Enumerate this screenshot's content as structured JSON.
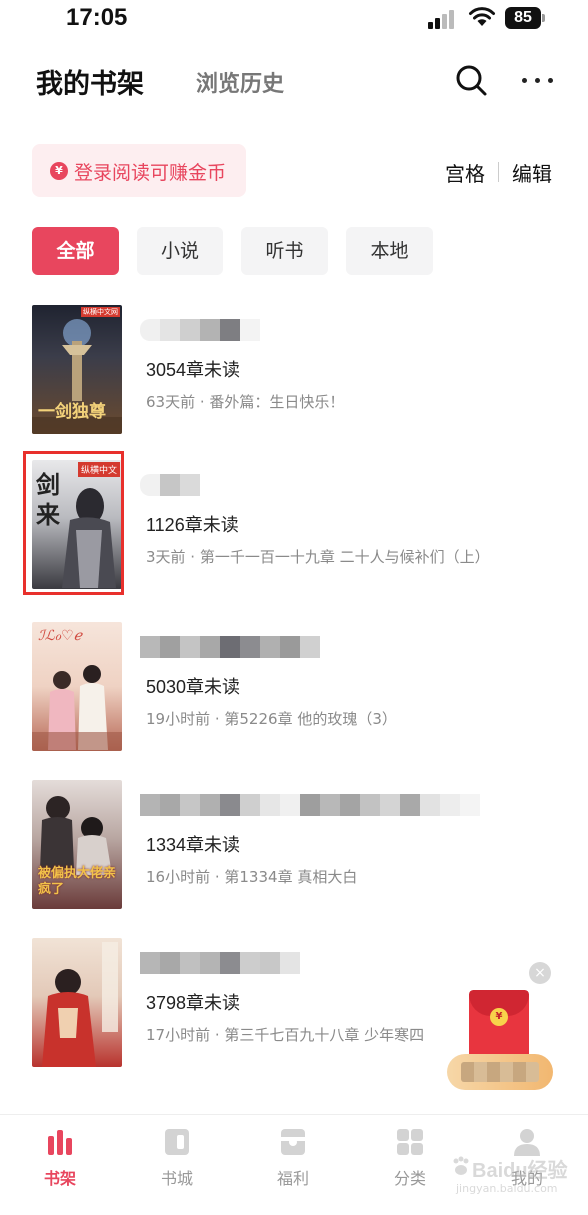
{
  "status_bar": {
    "time": "17:05",
    "battery": "85"
  },
  "header": {
    "tab_shelf": "我的书架",
    "tab_history": "浏览历史"
  },
  "banner": {
    "coin_symbol": "¥",
    "text": "登录阅读可赚金币"
  },
  "view_toggle": {
    "grid_label": "宫格",
    "edit_label": "编辑"
  },
  "filters": [
    {
      "label": "全部",
      "active": true
    },
    {
      "label": "小说",
      "active": false
    },
    {
      "label": "听书",
      "active": false
    },
    {
      "label": "本地",
      "active": false
    }
  ],
  "books": [
    {
      "unread": "3054章未读",
      "meta": "63天前 · 番外篇：生日快乐！",
      "cover_text": "一剑独尊",
      "cover_badge": "纵横中文网",
      "cover_colors": [
        "#2a2d38",
        "#6b4a2e"
      ]
    },
    {
      "unread": "1126章未读",
      "meta": "3天前 · 第一千一百一十九章 二十人与候补们（上）",
      "cover_text": "剑来",
      "cover_badge": "纵横中文",
      "cover_colors": [
        "#c9cbd0",
        "#3a3a40"
      ]
    },
    {
      "unread": "5030章未读",
      "meta": "19小时前 · 第5226章 他的玫瑰（3）",
      "cover_text": "",
      "cover_badge": "",
      "cover_colors": [
        "#f3ddd0",
        "#b86a58"
      ]
    },
    {
      "unread": "1334章未读",
      "meta": "16小时前 · 第1334章 真相大白",
      "cover_text": "被偏执大佬亲疯了",
      "cover_badge": "",
      "cover_colors": [
        "#d9d2cf",
        "#6a3b3a"
      ]
    },
    {
      "unread": "3798章未读",
      "meta": "17小时前 · 第三千七百九十八章 少年寒四",
      "cover_text": "",
      "cover_badge": "",
      "cover_colors": [
        "#e9d6c8",
        "#b8332e"
      ]
    }
  ],
  "redpacket": {
    "close_symbol": "×",
    "seal": "¥"
  },
  "tab_bar": [
    {
      "label": "书架",
      "icon": "bookshelf-icon",
      "active": true
    },
    {
      "label": "书城",
      "icon": "book-store-icon",
      "active": false
    },
    {
      "label": "福利",
      "icon": "gift-box-icon",
      "active": false
    },
    {
      "label": "分类",
      "icon": "category-grid-icon",
      "active": false
    },
    {
      "label": "我的",
      "icon": "profile-icon",
      "active": false
    }
  ],
  "watermark": {
    "text": "Baidu经验",
    "sub": "jingyan.baidu.com"
  },
  "colors": {
    "accent": "#e8465e",
    "highlight": "#e8302c"
  }
}
